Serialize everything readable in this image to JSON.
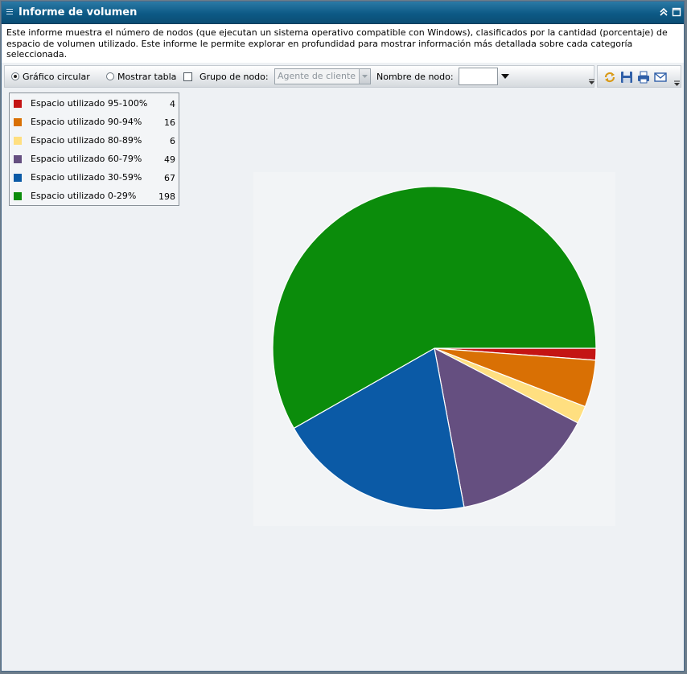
{
  "window": {
    "title": "Informe de volumen"
  },
  "description": "Este informe muestra el número de nodos (que ejecutan un sistema operativo compatible con Windows), clasificados por la cantidad (porcentaje) de espacio de volumen utilizado. Este informe le permite explorar en profundidad para mostrar información más detallada sobre cada categoría seleccionada.",
  "toolbar": {
    "view_options": [
      {
        "label": "Gráfico circular",
        "selected": true
      },
      {
        "label": "Mostrar tabla",
        "selected": false
      }
    ],
    "node_group_checkbox_checked": false,
    "node_group_label": "Grupo de nodo:",
    "node_group_value": "Agente de cliente",
    "node_name_label": "Nombre de nodo:",
    "node_name_value": ""
  },
  "actions": {
    "icons": [
      "refresh-icon",
      "save-icon",
      "print-icon",
      "email-icon"
    ]
  },
  "chart_data": {
    "type": "pie",
    "categories": [
      "Espacio utilizado 95-100%",
      "Espacio utilizado 90-94%",
      "Espacio utilizado 80-89%",
      "Espacio utilizado 60-79%",
      "Espacio utilizado 30-59%",
      "Espacio utilizado 0-29%"
    ],
    "values": [
      4,
      16,
      6,
      49,
      67,
      198
    ],
    "colors": [
      "#c41414",
      "#d97004",
      "#ffdf80",
      "#654f80",
      "#0b5aa6",
      "#0b8c0b"
    ],
    "legend_position": "top-left",
    "start_angle_deg": 0,
    "direction": "clockwise"
  }
}
